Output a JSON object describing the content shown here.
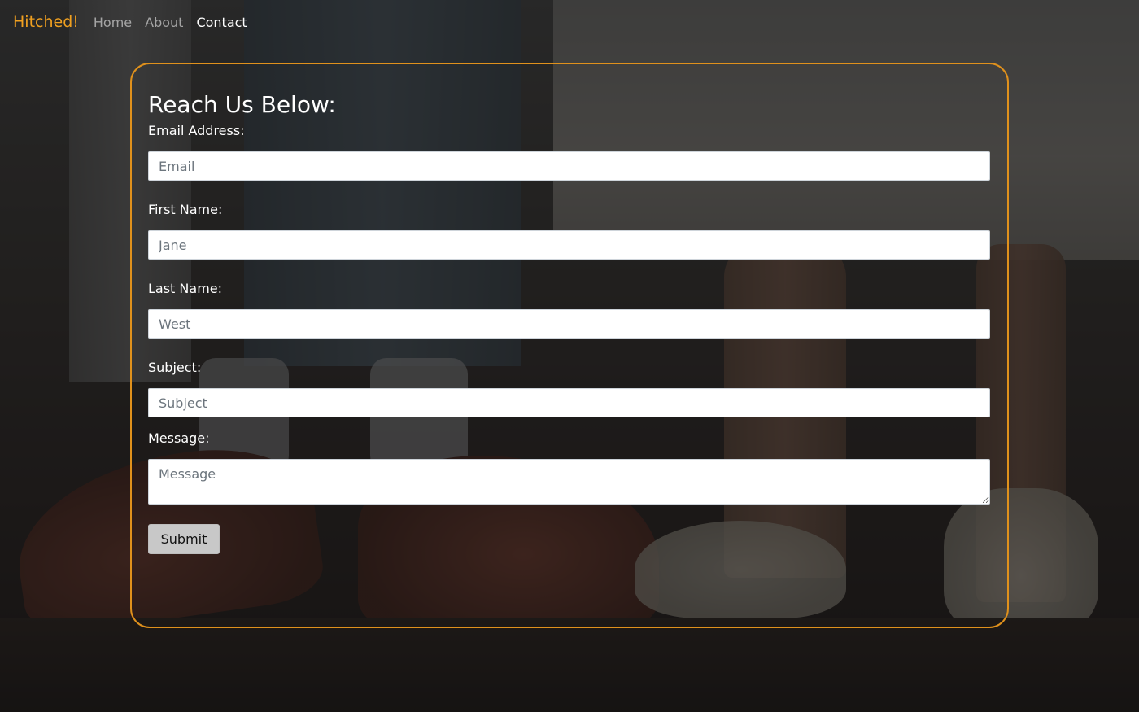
{
  "navbar": {
    "brand": "Hitched!",
    "links": [
      {
        "label": "Home",
        "active": false
      },
      {
        "label": "About",
        "active": false
      },
      {
        "label": "Contact",
        "active": true
      }
    ]
  },
  "form": {
    "title": "Reach Us Below:",
    "fields": {
      "email": {
        "label": "Email Address:",
        "placeholder": "Email",
        "value": ""
      },
      "first_name": {
        "label": "First Name:",
        "placeholder": "Jane",
        "value": ""
      },
      "last_name": {
        "label": "Last Name:",
        "placeholder": "West",
        "value": ""
      },
      "subject": {
        "label": "Subject:",
        "placeholder": "Subject",
        "value": ""
      },
      "message": {
        "label": "Message:",
        "placeholder": "Message",
        "value": ""
      }
    },
    "submit_label": "Submit"
  },
  "colors": {
    "brand": "#f0a020",
    "card_border": "#e0911c",
    "overlay": "rgba(20,20,20,0.62)"
  }
}
